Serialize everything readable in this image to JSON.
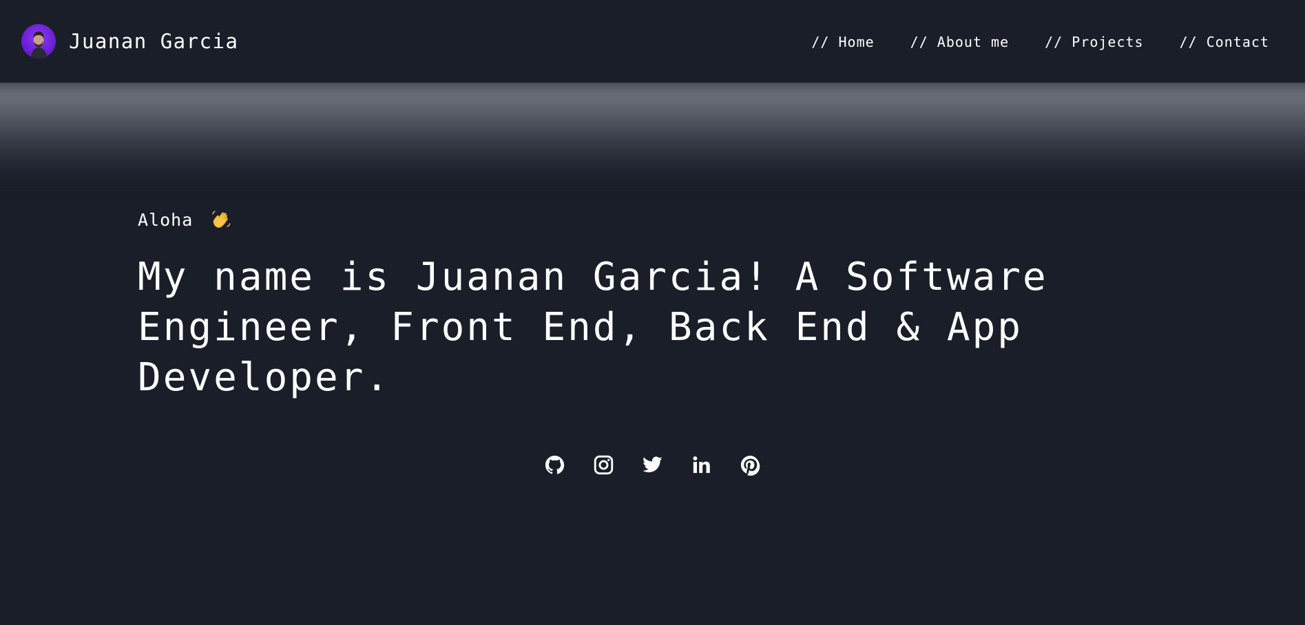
{
  "header": {
    "brand_name": "Juanan Garcia",
    "avatar_icon": "profile-photo",
    "nav": [
      {
        "label": "// Home"
      },
      {
        "label": "// About me"
      },
      {
        "label": "// Projects"
      },
      {
        "label": "// Contact"
      }
    ]
  },
  "hero": {
    "greeting": "Aloha",
    "greeting_icon": "waving-hand-emoji",
    "headline": "My name is Juanan Garcia! A Software Engineer, Front End, Back End & App Developer."
  },
  "socials": [
    {
      "icon": "github-icon"
    },
    {
      "icon": "instagram-icon"
    },
    {
      "icon": "twitter-icon"
    },
    {
      "icon": "linkedin-icon"
    },
    {
      "icon": "pinterest-icon"
    }
  ],
  "colors": {
    "background": "#191e28",
    "text": "#ffffff",
    "avatar_accent": "#6a1fd6",
    "hero_glow": "#7a7d86"
  }
}
